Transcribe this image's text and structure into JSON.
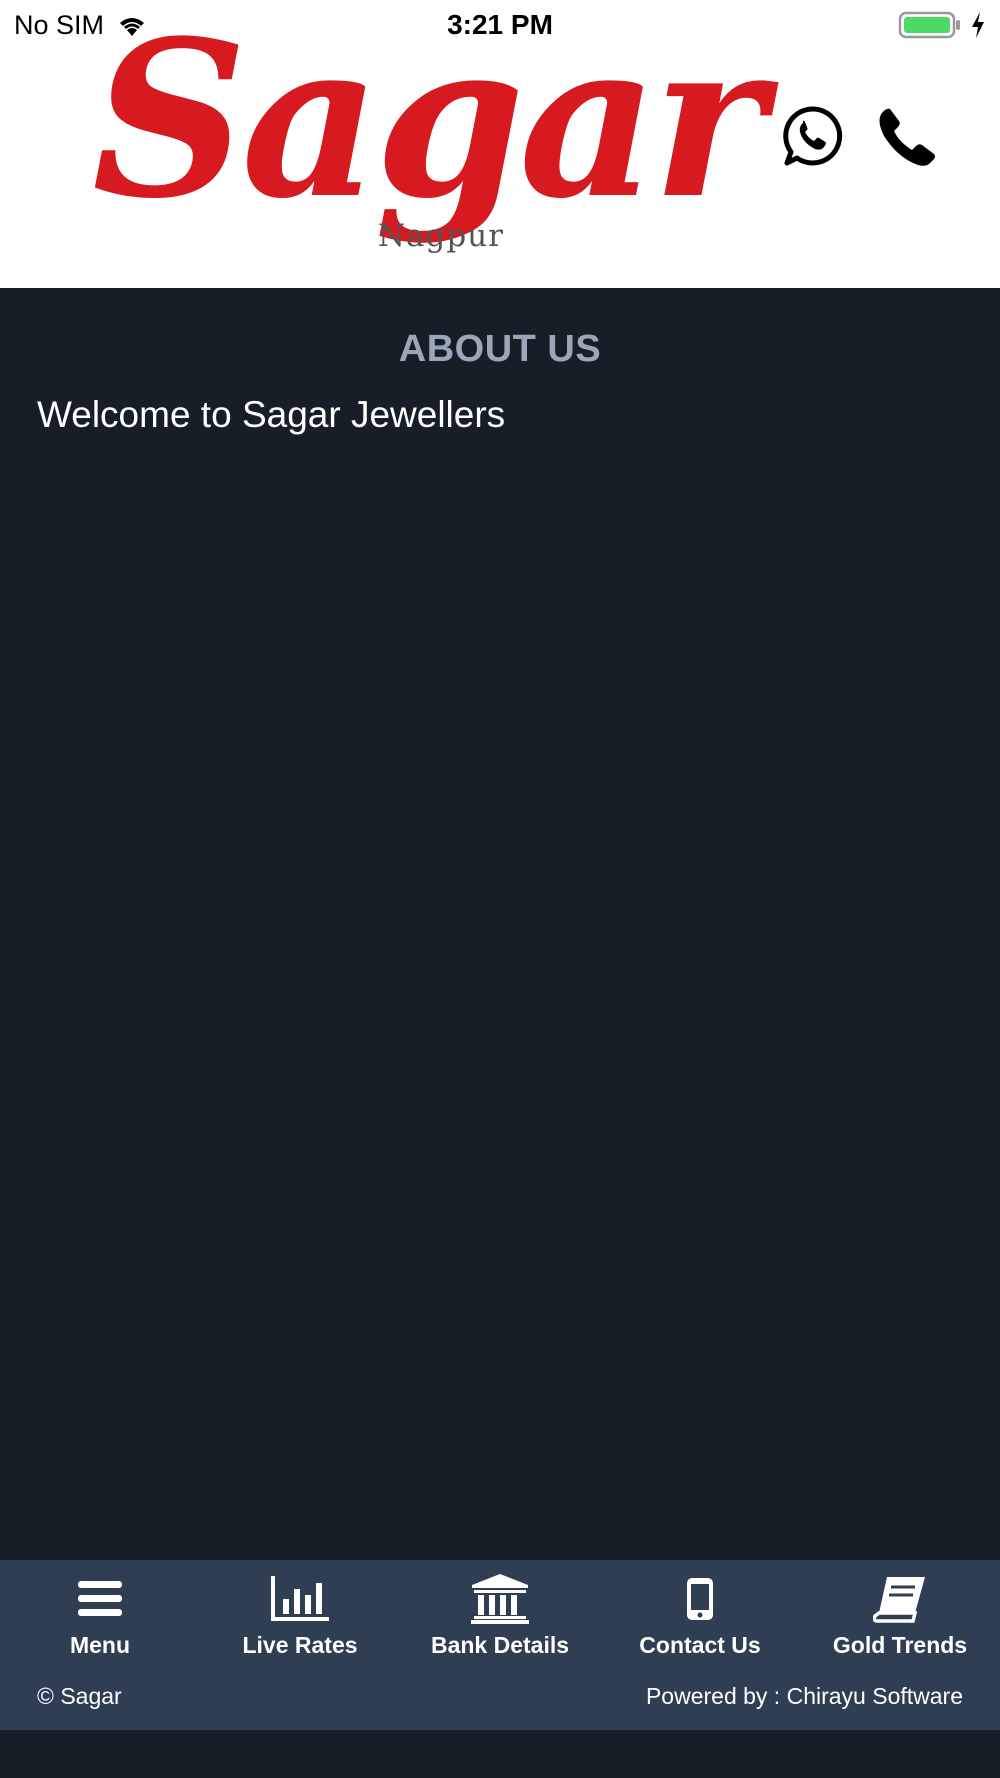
{
  "status_bar": {
    "carrier": "No SIM",
    "time": "3:21 PM"
  },
  "header": {
    "logo_text": "Sagar",
    "logo_subtitle": "Nagpur"
  },
  "main": {
    "title": "ABOUT US",
    "welcome_text": "Welcome to Sagar Jewellers"
  },
  "nav": {
    "items": [
      {
        "label": "Menu",
        "icon": "menu-icon"
      },
      {
        "label": "Live Rates",
        "icon": "bar-chart-icon"
      },
      {
        "label": "Bank Details",
        "icon": "bank-icon"
      },
      {
        "label": "Contact Us",
        "icon": "mobile-phone-icon"
      },
      {
        "label": "Gold Trends",
        "icon": "book-icon"
      }
    ]
  },
  "footer": {
    "copyright": "© Sagar",
    "powered_by": "Powered by : Chirayu Software"
  },
  "colors": {
    "brand_red": "#d71920",
    "background": "#161f28",
    "bottom_bar": "#2f3e53",
    "title_gray": "#9ba7b8",
    "battery_green": "#4cd964"
  }
}
